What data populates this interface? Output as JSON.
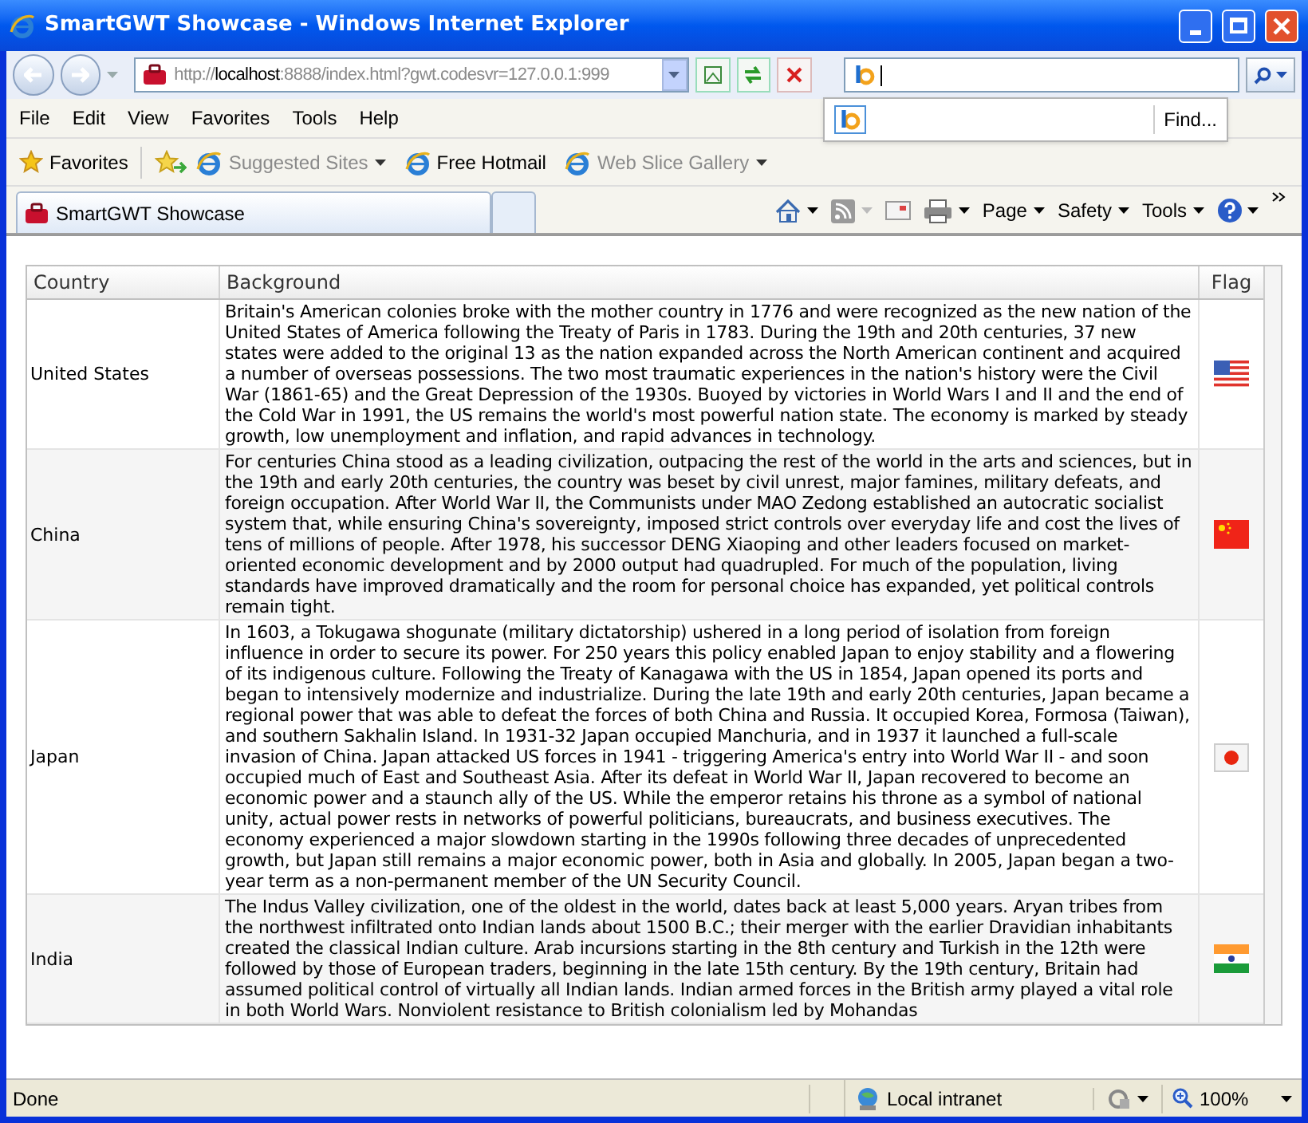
{
  "window": {
    "title": "SmartGWT Showcase - Windows Internet Explorer"
  },
  "address": {
    "scheme": "http://",
    "host": "localhost",
    "path": ":8888/index.html?gwt.codesvr=127.0.0.1:999"
  },
  "search": {
    "dropdown_item": "Find..."
  },
  "menu": [
    "File",
    "Edit",
    "View",
    "Favorites",
    "Tools",
    "Help"
  ],
  "favorites_bar": {
    "label": "Favorites",
    "items": [
      {
        "label": "Suggested Sites",
        "dimmed": true,
        "dropdown": true
      },
      {
        "label": "Free Hotmail",
        "dimmed": false,
        "dropdown": false
      },
      {
        "label": "Web Slice Gallery",
        "dimmed": true,
        "dropdown": true
      }
    ]
  },
  "tabs": [
    {
      "label": "SmartGWT Showcase",
      "selected": true
    },
    {
      "selected": false
    }
  ],
  "command_bar": [
    "Page",
    "Safety",
    "Tools"
  ],
  "table": {
    "columns": [
      "Country",
      "Background",
      "Flag"
    ],
    "rows": [
      {
        "country": "United States",
        "background": "Britain's American colonies broke with the mother country in 1776 and were recognized as the new nation of the United States of America following the Treaty of Paris in 1783. During the 19th and 20th centuries, 37 new states were added to the original 13 as the nation expanded across the North American continent and acquired a number of overseas possessions. The two most traumatic experiences in the nation's history were the Civil War (1861-65) and the Great Depression of the 1930s. Buoyed by victories in World Wars I and II and the end of the Cold War in 1991, the US remains the world's most powerful nation state. The economy is marked by steady growth, low unemployment and inflation, and rapid advances in technology.",
        "flag": {
          "kind": "stripes"
        }
      },
      {
        "country": "China",
        "background": "For centuries China stood as a leading civilization, outpacing the rest of the world in the arts and sciences, but in the 19th and early 20th centuries, the country was beset by civil unrest, major famines, military defeats, and foreign occupation. After World War II, the Communists under MAO Zedong established an autocratic socialist system that, while ensuring China's sovereignty, imposed strict controls over everyday life and cost the lives of tens of millions of people. After 1978, his successor DENG Xiaoping and other leaders focused on market-oriented economic development and by 2000 output had quadrupled. For much of the population, living standards have improved dramatically and the room for personal choice has expanded, yet political controls remain tight.",
        "flag": {
          "kind": "stars"
        }
      },
      {
        "country": "Japan",
        "background": "In 1603, a Tokugawa shogunate (military dictatorship) ushered in a long period of isolation from foreign influence in order to secure its power. For 250 years this policy enabled Japan to enjoy stability and a flowering of its indigenous culture. Following the Treaty of Kanagawa with the US in 1854, Japan opened its ports and began to intensively modernize and industrialize. During the late 19th and early 20th centuries, Japan became a regional power that was able to defeat the forces of both China and Russia. It occupied Korea, Formosa (Taiwan), and southern Sakhalin Island. In 1931-32 Japan occupied Manchuria, and in 1937 it launched a full-scale invasion of China. Japan attacked US forces in 1941 - triggering America's entry into World War II - and soon occupied much of East and Southeast Asia. After its defeat in World War II, Japan recovered to become an economic power and a staunch ally of the US. While the emperor retains his throne as a symbol of national unity, actual power rests in networks of powerful politicians, bureaucrats, and business executives. The economy experienced a major slowdown starting in the 1990s following three decades of unprecedented growth, but Japan still remains a major economic power, both in Asia and globally. In 2005, Japan began a two-year term as a non-permanent member of the UN Security Council.",
        "flag": {
          "kind": "disc"
        }
      },
      {
        "country": "India",
        "background": "The Indus Valley civilization, one of the oldest in the world, dates back at least 5,000 years. Aryan tribes from the northwest infiltrated onto Indian lands about 1500 B.C.; their merger with the earlier Dravidian inhabitants created the classical Indian culture. Arab incursions starting in the 8th century and Turkish in the 12th were followed by those of European traders, beginning in the late 15th century. By the 19th century, Britain had assumed political control of virtually all Indian lands. Indian armed forces in the British army played a vital role in both World Wars. Nonviolent resistance to British colonialism led by Mohandas",
        "flag": {
          "kind": "tricolor"
        }
      }
    ]
  },
  "status_bar": {
    "status": "Done",
    "zone": "Local intranet",
    "zoom": "100%"
  }
}
